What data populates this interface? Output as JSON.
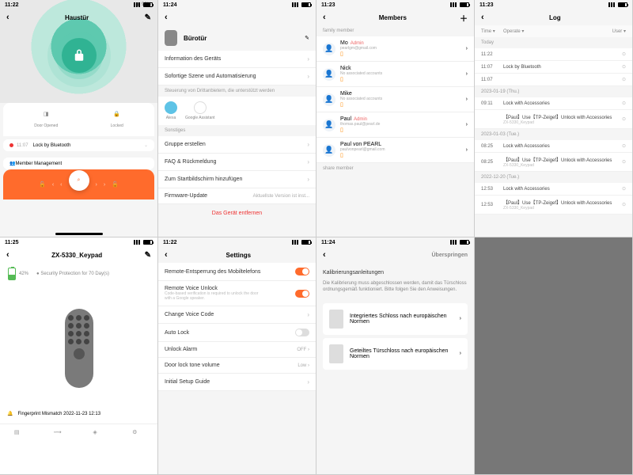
{
  "s1": {
    "time": "11:22",
    "title": "Haustür",
    "battery": "90%",
    "state1": "Door Opened",
    "state2": "Locked",
    "evTime": "11:07",
    "evText": "Lock by Bluetooth",
    "member": "Member Management"
  },
  "s2": {
    "time": "11:24",
    "title": "Bürotür",
    "rows": [
      "Information des Geräts",
      "Sofortige Szene und Automatisierung"
    ],
    "voiceHead": "Steuerung von Drittanbietern, die unterstützt werden",
    "voice": [
      "Alexa",
      "Google Assistant"
    ],
    "sect": "Sonstiges",
    "rows2": [
      "Gruppe erstellen",
      "FAQ & Rückmeldung",
      "Zum Startbildschirm hinzufügen"
    ],
    "fw": "Firmware-Update",
    "fwVal": "Aktuellste Version ist inst...",
    "remove": "Das Gerät entfernen"
  },
  "s3": {
    "time": "11:23",
    "title": "Members",
    "sect1": "family member",
    "sect2": "share member",
    "members": [
      {
        "name": "Mo",
        "admin": true,
        "sub": "pearlgm@gmail.com"
      },
      {
        "name": "Nick",
        "admin": false,
        "sub": "No associated accounts"
      },
      {
        "name": "Mike",
        "admin": false,
        "sub": "No associated accounts"
      },
      {
        "name": "Paul",
        "admin": true,
        "sub": "thomas.paul@pearl.de"
      },
      {
        "name": "Paul von PEARL",
        "admin": false,
        "sub": "paulvonpearl@gmail.com"
      }
    ]
  },
  "s4": {
    "time": "11:23",
    "title": "Log",
    "cols": [
      "Time",
      "Operate",
      "User"
    ],
    "groups": [
      {
        "date": "Today",
        "rows": [
          {
            "t": "11:22",
            "op": "",
            "u": ""
          },
          {
            "t": "11:07",
            "op": "Lock by Bluetooth",
            "u": ""
          },
          {
            "t": "11:07",
            "op": "",
            "u": ""
          }
        ]
      },
      {
        "date": "2023-01-19 (Thu.)",
        "rows": [
          {
            "t": "09:11",
            "op": "Lock with Accessories",
            "u": ""
          },
          {
            "t": "",
            "op": "【Paul】Use【TP-Zeigef】Unlock with Accessories",
            "u": "ZX-5330_Keypad"
          }
        ]
      },
      {
        "date": "2023-01-03 (Tue.)",
        "rows": [
          {
            "t": "08:25",
            "op": "Lock with Accessories",
            "u": ""
          },
          {
            "t": "08:25",
            "op": "【Paul】Use【TP-Zeigef】Unlock with Accessories",
            "u": "ZX-5330_Keypad"
          }
        ]
      },
      {
        "date": "2022-12-20 (Tue.)",
        "rows": [
          {
            "t": "12:53",
            "op": "Lock with Accessories",
            "u": ""
          },
          {
            "t": "12:53",
            "op": "【Paul】Use【TP-Zeigef】Unlock with Accessories",
            "u": "ZX-5330_Keypad"
          }
        ]
      }
    ]
  },
  "s5": {
    "time": "11:25",
    "title": "ZX-5330_Keypad",
    "battPct": "42%",
    "sec": "Security Protection for 70 Day(s)",
    "ev": "Fingerprint Mismatch 2022-11-23 12:13"
  },
  "s6": {
    "time": "11:22",
    "title": "Settings",
    "rows": [
      {
        "l": "Remote-Entsperrung des Mobiltelefons",
        "type": "toggle",
        "on": true
      },
      {
        "l": "Remote Voice Unlock",
        "sub": "Code-based verification is required to unlock the door with a Google speaker.",
        "type": "toggle",
        "on": true
      },
      {
        "l": "Change Voice Code",
        "type": "chev"
      },
      {
        "l": "Auto Lock",
        "type": "toggle",
        "on": false
      },
      {
        "l": "Unlock Alarm",
        "type": "val",
        "v": "OFF"
      },
      {
        "l": "Door lock tone volume",
        "type": "val",
        "v": "Low"
      },
      {
        "l": "Initial Setup Guide",
        "type": "chev"
      }
    ]
  },
  "s7": {
    "time": "11:24",
    "skip": "Überspringen",
    "head": "Kalibrierungsanleitungen",
    "text": "Die Kalibrierung muss abgeschlossen werden, damit das Türschloss ordnungsgemäß funktioniert. Bitte folgen Sie den Anweisungen.",
    "opt1": "Integriertes Schloss nach europäischen Normen",
    "opt2": "Geteiltes Türschloss nach europäischen Normen"
  }
}
